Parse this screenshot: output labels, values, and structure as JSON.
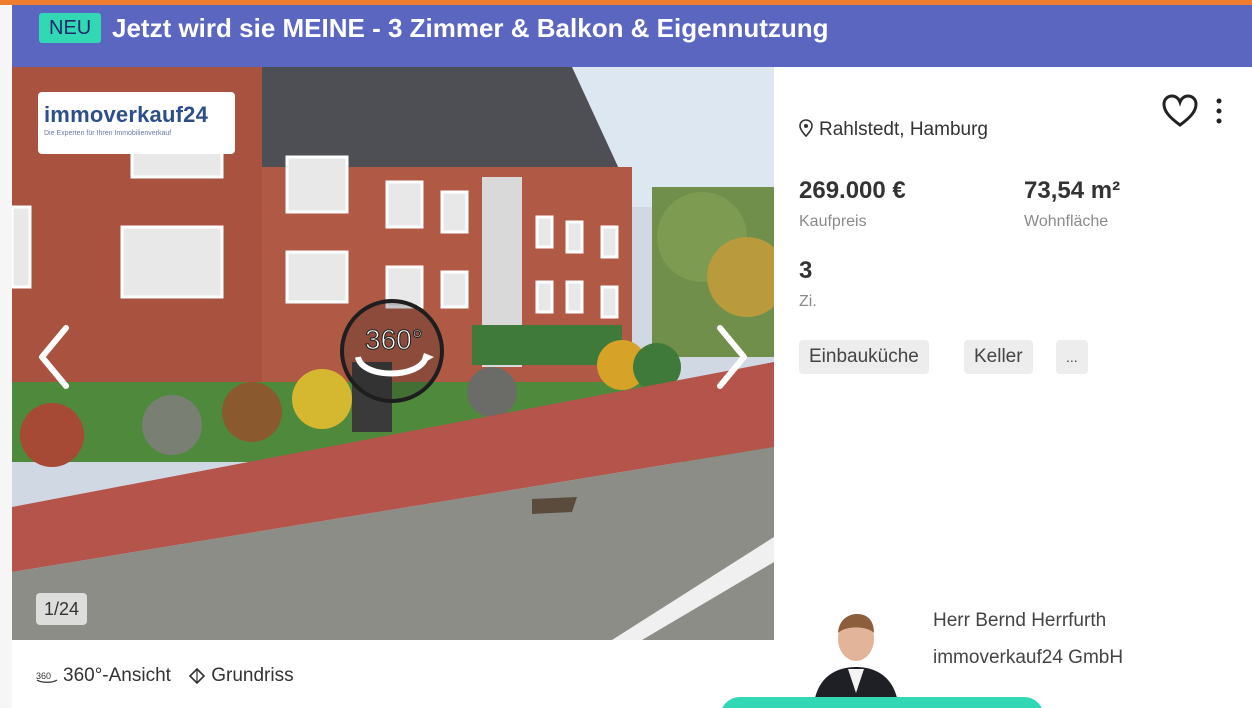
{
  "header": {
    "badge": "NEU",
    "title": "Jetzt wird sie MEINE - 3 Zimmer & Balkon & Eigennutzung"
  },
  "gallery": {
    "logo_text": "immoverkauf24",
    "logo_tagline": "Die Experten für Ihren Immobilienverkauf",
    "pano_label": "360°",
    "counter": "1/24"
  },
  "listing": {
    "location": "Rahlstedt, Hamburg",
    "price": "269.000 €",
    "price_label": "Kaufpreis",
    "area": "73,54 m²",
    "area_label": "Wohnfläche",
    "rooms": "3",
    "rooms_label": "Zi.",
    "tags": [
      "Einbauküche",
      "Keller",
      "..."
    ]
  },
  "features": {
    "view360": "360°-Ansicht",
    "floorplan": "Grundriss"
  },
  "agent": {
    "name": "Herr Bernd Herrfurth",
    "company": "immoverkauf24 GmbH"
  },
  "colors": {
    "header": "#5a66c0",
    "badge": "#32d8b4",
    "accent": "#f07d2f"
  },
  "icons": [
    "location-pin-icon",
    "heart-icon",
    "more-vertical-icon",
    "chevron-left-icon",
    "chevron-right-icon",
    "360-icon",
    "floorplan-icon"
  ]
}
